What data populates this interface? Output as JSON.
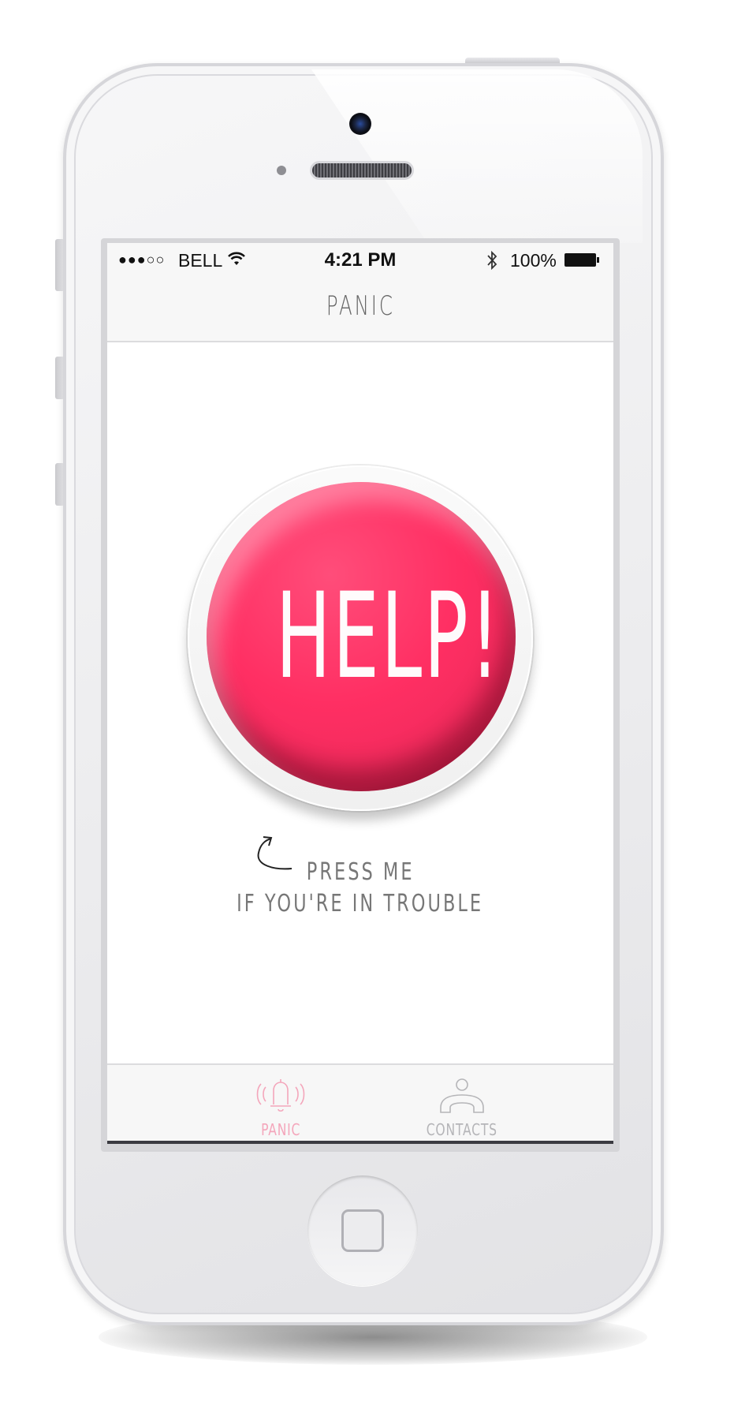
{
  "status_bar": {
    "signal_dots": "●●●○○",
    "carrier": "BELL",
    "time": "4:21 PM",
    "battery_percent": "100%"
  },
  "navbar": {
    "title": "PANIC"
  },
  "help_button": {
    "label": "HELP!"
  },
  "hint": {
    "line1": "PRESS ME",
    "line2": "IF YOU'RE IN TROUBLE"
  },
  "tabbar": {
    "tabs": [
      {
        "label": "PANIC",
        "icon": "bell-alarm-icon",
        "active": true
      },
      {
        "label": "CONTACTS",
        "icon": "contact-person-icon",
        "active": false
      }
    ]
  },
  "colors": {
    "accent": "#ff2f63",
    "active_tab": "#f4a6bb",
    "inactive_tab": "#b5b5b8"
  }
}
